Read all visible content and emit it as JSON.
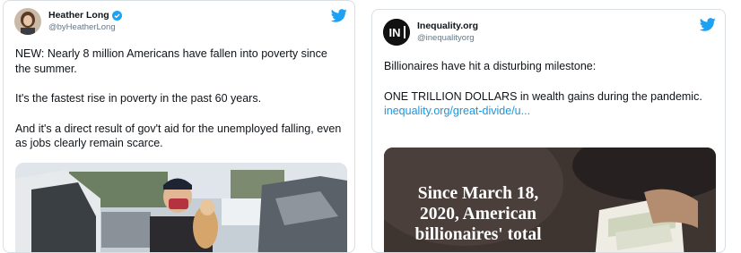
{
  "tweets": [
    {
      "name": "Heather Long",
      "handle": "@byHeatherLong",
      "paragraphs": [
        "NEW: Nearly 8 million Americans have fallen into poverty since the summer.",
        "It's the fastest rise in poverty in the past 60 years.",
        "And it's a direct result of gov't aid for the unemployed falling, even as jobs clearly remain scarce."
      ],
      "verified": true,
      "icons": [
        "verified-badge-icon",
        "twitter-bird-icon"
      ]
    },
    {
      "name": "Inequality.org",
      "handle": "@inequalityorg",
      "avatar_text": "IN",
      "paragraphs": [
        "Billionaires have hit a disturbing milestone:",
        "ONE TRILLION DOLLARS in wealth gains during the pandemic."
      ],
      "link": "inequality.org/great-divide/u...",
      "image_text": [
        "Since March 18,",
        "2020, American",
        "billionaires' total"
      ],
      "icons": [
        "twitter-bird-icon"
      ]
    }
  ],
  "colors": {
    "brand_blue": "#1da1f2",
    "link_blue": "#1b95e0",
    "handle_gray": "#657786",
    "border": "#d9dee2"
  }
}
